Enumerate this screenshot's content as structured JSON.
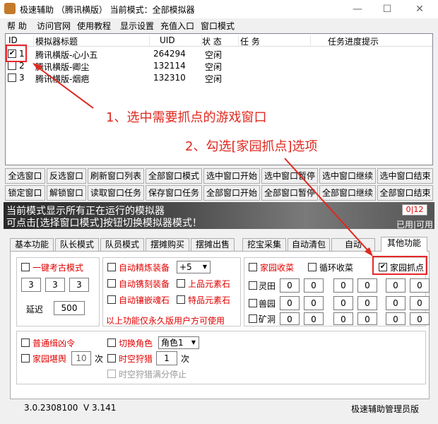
{
  "window": {
    "title": "极速辅助 （腾讯横版）     当前模式：全部模拟器"
  },
  "menu": [
    "帮 助",
    "访问官网",
    "使用教程",
    "显示设置",
    "充值入口",
    "窗口模式"
  ],
  "table": {
    "headers": [
      "ID",
      "模拟器标题",
      "UID",
      "状 态",
      "任 务",
      "任务进度提示"
    ],
    "rows": [
      {
        "id": "1",
        "title": "腾讯横版-心小五",
        "uid": "264294",
        "status": "空闲",
        "checked": true
      },
      {
        "id": "2",
        "title": "腾讯横版-卿尘",
        "uid": "132114",
        "status": "空闲",
        "checked": false
      },
      {
        "id": "3",
        "title": "腾讯横版-烟疤",
        "uid": "132310",
        "status": "空闲",
        "checked": false
      }
    ]
  },
  "buttons_row1": [
    "全选窗口",
    "反选窗口",
    "刷新窗口列表",
    "全部窗口模式",
    "选中窗口开始",
    "选中窗口暂停",
    "选中窗口继续",
    "选中窗口结束"
  ],
  "buttons_row2": [
    "锁定窗口",
    "解锁窗口",
    "读取窗口任务",
    "保存窗口任务",
    "全部窗口开始",
    "全部窗口暂停",
    "全部窗口继续",
    "全部窗口结束"
  ],
  "banner": {
    "line1": "当前模式显示所有正在运行的模拟器",
    "line2": "可点击[选择窗口模式]按钮切换模拟器模式！",
    "counter": "0|12",
    "usage": "已用|可用"
  },
  "tabs": [
    "基本功能",
    "队长模式",
    "队员模式",
    "摆摊购买",
    "摆摊出售",
    "挖宝采集",
    "自动清包",
    "自动",
    "其他功能"
  ],
  "panel": {
    "g1": {
      "yijian": "一键考古模式",
      "n1": "3",
      "n2": "3",
      "n3": "3",
      "delay_label": "延迟",
      "delay": "500"
    },
    "g2": {
      "jinglian": "自动精炼装备",
      "jinglian_val": "+5",
      "diaoke": "自动镌刻装备",
      "shangpin": "上品元素石",
      "xiangqian": "自动镶嵌魂石",
      "tepin": "特品元素石",
      "note": "以上功能仅永久版用户方可使用"
    },
    "g3": {
      "jiayuan_shoucai": "家园收菜",
      "xunhuan": "循环收菜",
      "jiayuan_zhuadian": "家园抓点",
      "lingtian": "灵田",
      "shouyuan": "兽园",
      "kuangdong": "矿洞",
      "zero": "0"
    },
    "g4": {
      "putong": "普通缉凶令",
      "qiehuan": "切换角色",
      "role": "角色1",
      "kanyu": "家园堪舆",
      "kanyu_val": "10",
      "ci": "次",
      "shikong": "时空狩猎",
      "shikong_val": "1",
      "shikong_full": "时空狩猎满分停止"
    }
  },
  "status": {
    "version": "3.0.2308100",
    "v": "V 3.141",
    "edition": "极速辅助管理员版"
  },
  "annotations": {
    "step1": "1、选中需要抓点的游戏窗口",
    "step2": "2、勾选[家园抓点]选项"
  },
  "colors": {
    "annotation": "#e0281e",
    "label_red": "#e00000"
  }
}
